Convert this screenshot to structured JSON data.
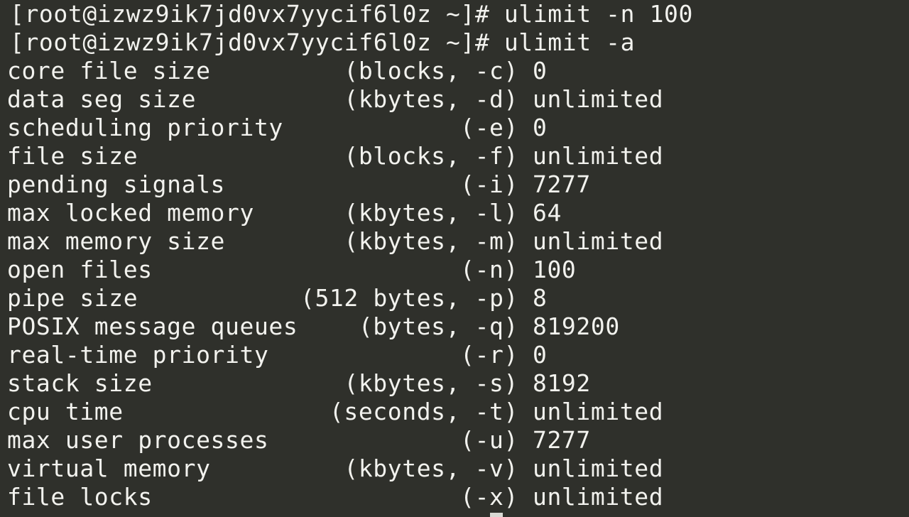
{
  "terminal": {
    "prompt": "[root@izwz9ik7jd0vx7yycif6l0z ~]#",
    "commands": [
      "ulimit -n 100",
      "ulimit -a"
    ],
    "rows": [
      {
        "label": "core file size",
        "unit": "(blocks, -c)",
        "value": "0"
      },
      {
        "label": "data seg size",
        "unit": "(kbytes, -d)",
        "value": "unlimited"
      },
      {
        "label": "scheduling priority",
        "unit": "(-e)",
        "value": "0"
      },
      {
        "label": "file size",
        "unit": "(blocks, -f)",
        "value": "unlimited"
      },
      {
        "label": "pending signals",
        "unit": "(-i)",
        "value": "7277"
      },
      {
        "label": "max locked memory",
        "unit": "(kbytes, -l)",
        "value": "64"
      },
      {
        "label": "max memory size",
        "unit": "(kbytes, -m)",
        "value": "unlimited"
      },
      {
        "label": "open files",
        "unit": "(-n)",
        "value": "100"
      },
      {
        "label": "pipe size",
        "unit": "(512 bytes, -p)",
        "value": "8"
      },
      {
        "label": "POSIX message queues",
        "unit": "(bytes, -q)",
        "value": "819200"
      },
      {
        "label": "real-time priority",
        "unit": "(-r)",
        "value": "0"
      },
      {
        "label": "stack size",
        "unit": "(kbytes, -s)",
        "value": "8192"
      },
      {
        "label": "cpu time",
        "unit": "(seconds, -t)",
        "value": "unlimited"
      },
      {
        "label": "max user processes",
        "unit": "(-u)",
        "value": "7277"
      },
      {
        "label": "virtual memory",
        "unit": "(kbytes, -v)",
        "value": "unlimited"
      },
      {
        "label": "file locks",
        "unit": "(-x)",
        "value": "unlimited"
      }
    ]
  },
  "colors": {
    "background": "#2f302b",
    "foreground": "#f2f2ee",
    "cursor": "#d9d9d4"
  }
}
